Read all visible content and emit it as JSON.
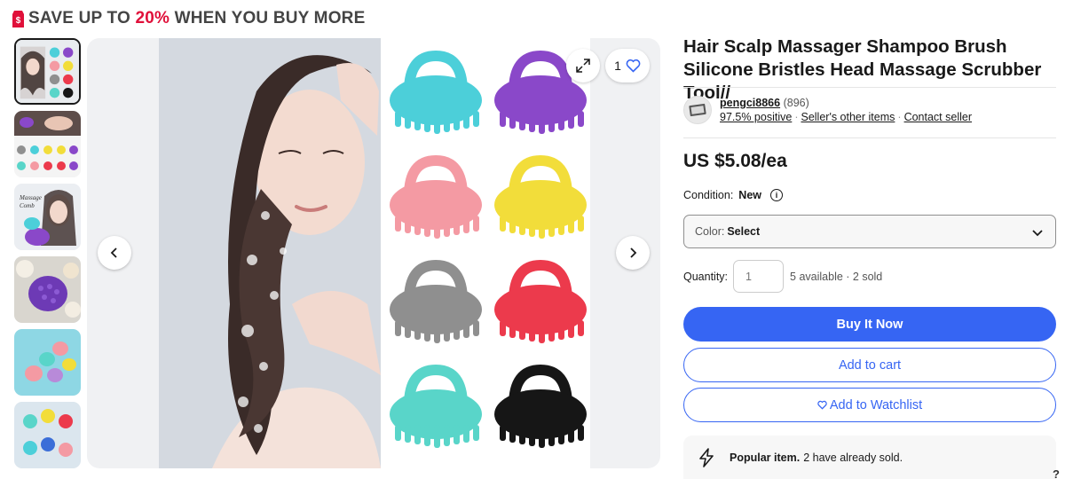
{
  "promo": {
    "prefix": "SAVE UP TO ",
    "percent": "20%",
    "suffix": " WHEN YOU BUY MORE",
    "accent_color": "#e0103a"
  },
  "gallery": {
    "thumbnails": [
      {
        "name": "thumb-woman-and-brush-colors",
        "selected": true
      },
      {
        "name": "thumb-brush-usage-colors"
      },
      {
        "name": "thumb-massage-comb"
      },
      {
        "name": "thumb-purple-brush-flowers"
      },
      {
        "name": "thumb-pastel-brushes"
      },
      {
        "name": "thumb-colorful-brushes"
      }
    ],
    "watch_count": "1",
    "icons": {
      "prev": "chevron-left-icon",
      "next": "chevron-right-icon",
      "expand": "expand-icon",
      "watch": "heart-icon"
    },
    "brush_colors": [
      "#4ccfd9",
      "#8a48c9",
      "#f49aa3",
      "#f2dd3a",
      "#8f8f8f",
      "#ec3a4c",
      "#59d5c9",
      "#161616"
    ]
  },
  "listing": {
    "title": "Hair Scalp Massager Shampoo Brush Silicone Bristles Head Massage Scrubber Tool//",
    "seller": {
      "name": "pengci8866",
      "feedback_count": "(896)",
      "positive": "97.5% positive",
      "other_items": "Seller's other items",
      "contact": "Contact seller"
    },
    "price": "US $5.08/ea",
    "condition_label": "Condition:",
    "condition_value": "New",
    "color_label": "Color:",
    "color_value": "Select",
    "quantity_label": "Quantity:",
    "quantity_placeholder": "1",
    "availability": "5 available · 2 sold",
    "buttons": {
      "buy": "Buy It Now",
      "cart": "Add to cart",
      "watch": "Add to Watchlist"
    },
    "popular": {
      "bold": "Popular item.",
      "text": "2 have already sold."
    },
    "help": "?",
    "brand_color": "#3665f3"
  }
}
